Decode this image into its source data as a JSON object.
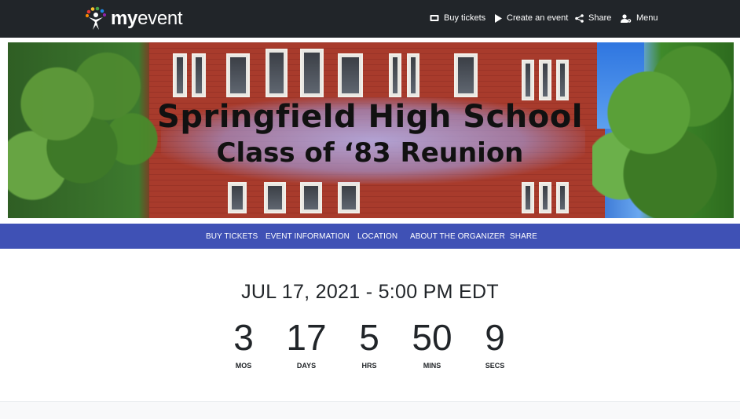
{
  "header": {
    "logo": {
      "text_bold": "my",
      "text_light": "event",
      "icon": "people-logo-icon"
    },
    "nav": [
      {
        "label": "Buy tickets",
        "icon": "ticket-icon"
      },
      {
        "label": "Create an event",
        "icon": "play-icon"
      },
      {
        "label": "Share",
        "icon": "share-icon"
      },
      {
        "label": "Menu",
        "icon": "user-gear-icon"
      }
    ]
  },
  "banner": {
    "title_line1": "Springfield High School",
    "title_line2": "Class of ‘83 Reunion"
  },
  "subnav": {
    "items": [
      {
        "label": "BUY TICKETS"
      },
      {
        "label": "EVENT INFORMATION"
      },
      {
        "label": "LOCATION"
      },
      {
        "label": "ABOUT THE ORGANIZER"
      },
      {
        "label": "SHARE"
      }
    ]
  },
  "countdown": {
    "date_text": "JUL 17, 2021 - 5:00 PM EDT",
    "units": [
      {
        "value": "3",
        "label": "MOS"
      },
      {
        "value": "17",
        "label": "DAYS"
      },
      {
        "value": "5",
        "label": "HRS"
      },
      {
        "value": "50",
        "label": "MINS"
      },
      {
        "value": "9",
        "label": "SECS"
      }
    ]
  },
  "colors": {
    "topbar": "#212529",
    "subnav": "#3f51b5",
    "text": "#212529"
  }
}
